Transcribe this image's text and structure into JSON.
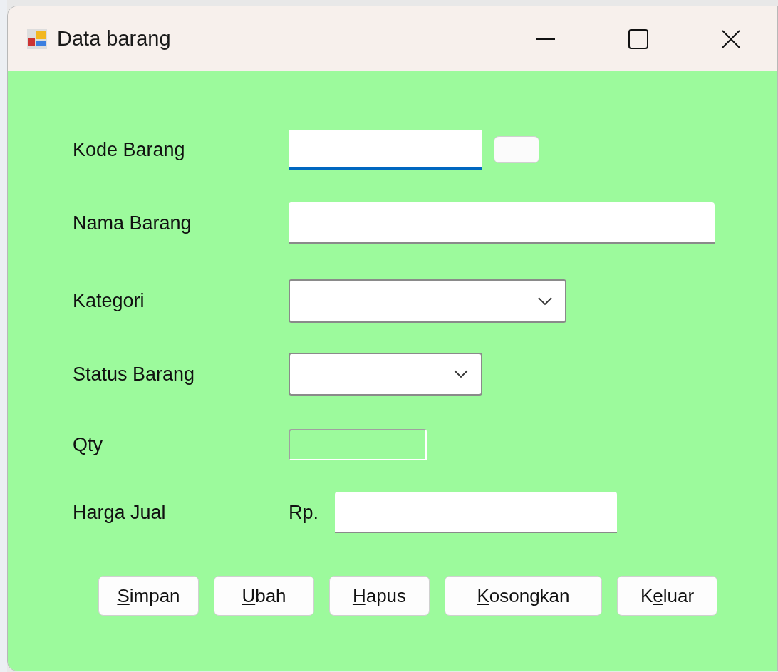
{
  "window": {
    "title": "Data barang"
  },
  "fields": [
    {
      "label": "Kode Barang",
      "kind": "text",
      "focused": true,
      "disabled": false,
      "side_button": true
    },
    {
      "label": "Nama Barang",
      "kind": "text",
      "focused": false,
      "disabled": false
    },
    {
      "label": "Kategori",
      "kind": "combo",
      "focused": false,
      "disabled": false
    },
    {
      "label": "Status Barang",
      "kind": "combo",
      "focused": false,
      "disabled": false
    },
    {
      "label": "Qty",
      "kind": "text",
      "focused": false,
      "disabled": true
    },
    {
      "label": "Harga Jual",
      "kind": "text",
      "focused": false,
      "disabled": false,
      "prefix": "Rp."
    }
  ],
  "buttons": [
    {
      "key": "S",
      "after": "impan"
    },
    {
      "key": "U",
      "after": "bah"
    },
    {
      "key": "H",
      "after": "apus"
    },
    {
      "key": "K",
      "after": "osongkan"
    },
    {
      "before": "K",
      "key": "e",
      "after": "luar"
    }
  ]
}
